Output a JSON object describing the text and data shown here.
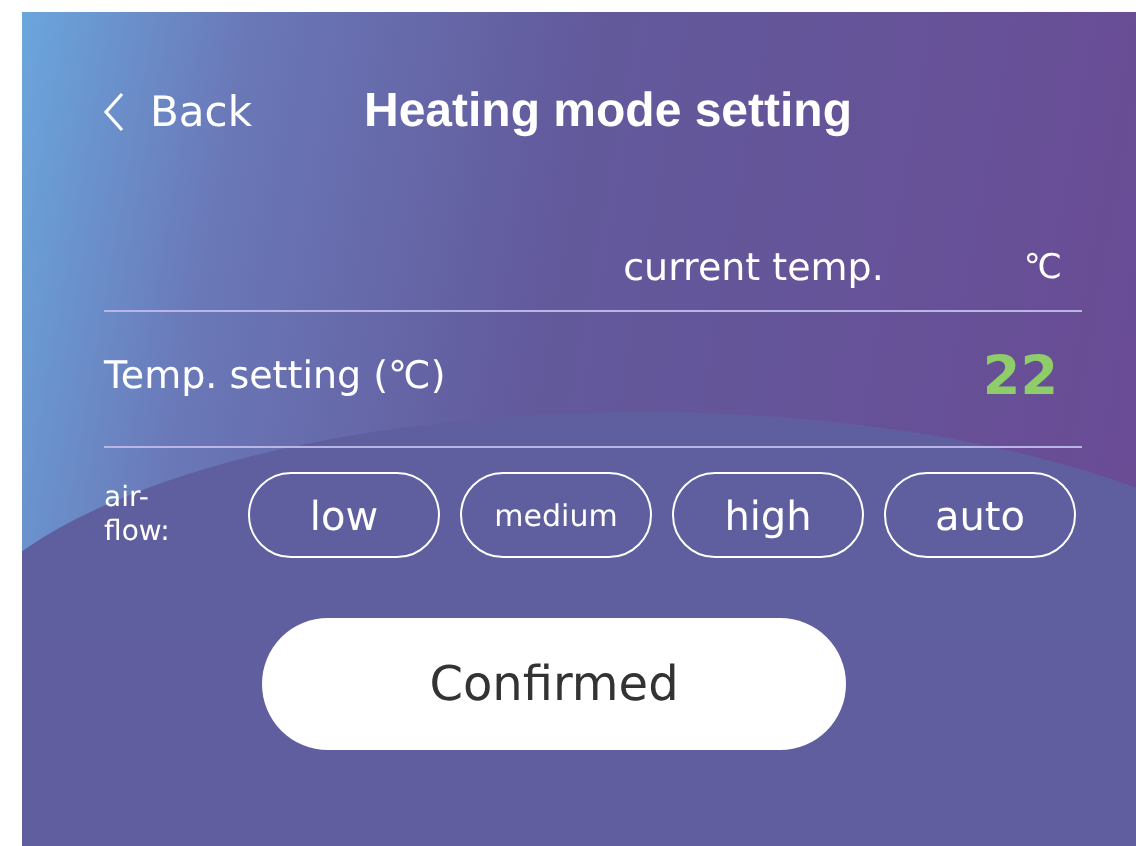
{
  "header": {
    "back": "Back",
    "title": "Heating mode setting"
  },
  "current_temp": {
    "label": "current temp.",
    "unit": "℃"
  },
  "temp_setting": {
    "label": "Temp. setting (℃)",
    "value": "22"
  },
  "airflow": {
    "label": "air-flow:",
    "options": [
      {
        "label": "low",
        "selected": false
      },
      {
        "label": "medium",
        "selected": false
      },
      {
        "label": "high",
        "selected": false
      },
      {
        "label": "auto",
        "selected": false
      }
    ]
  },
  "confirm": "Confirmed"
}
